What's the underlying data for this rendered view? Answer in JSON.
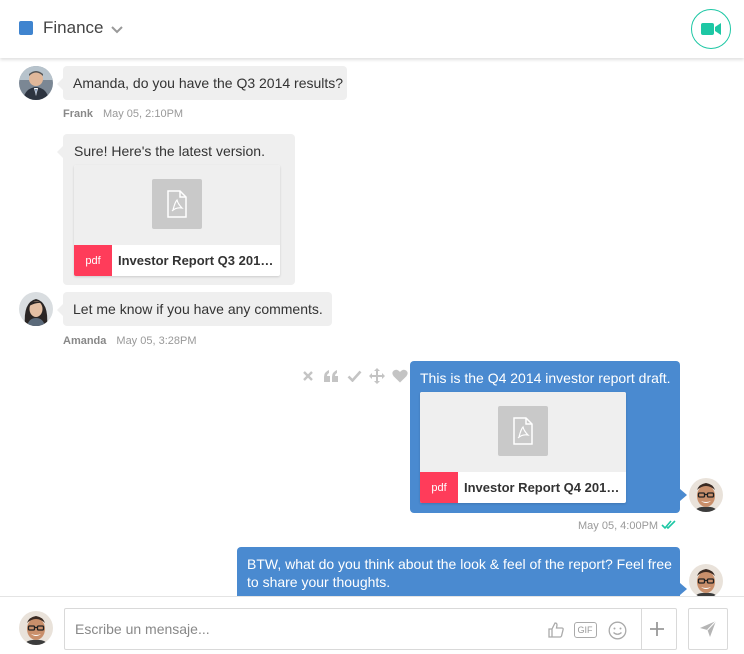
{
  "header": {
    "channel_name": "Finance",
    "channel_color": "#3f84cf",
    "accent_color": "#1dc7a4",
    "icons": {
      "channel": "square-icon",
      "dropdown": "chevron-down-icon",
      "video": "video-camera-icon"
    }
  },
  "messages": [
    {
      "direction": "incoming",
      "text": "Amanda, do you have the Q3 2014 results?",
      "sender": "Frank",
      "time": "May 05, 2:10PM"
    },
    {
      "direction": "incoming",
      "text": "Sure! Here's the latest version.",
      "attachment": {
        "type": "pdf",
        "name": "Investor Report Q3 2014...."
      }
    },
    {
      "direction": "incoming",
      "text": "Let me know if you have any comments.",
      "sender": "Amanda",
      "time": "May 05, 3:28PM"
    },
    {
      "direction": "outgoing",
      "text": "This is the Q4 2014 investor report draft.",
      "attachment": {
        "type": "pdf",
        "name": "Investor Report Q4 2014...."
      },
      "time": "May 05, 4:00PM",
      "status": "read"
    },
    {
      "direction": "outgoing",
      "text": "BTW, what do you think about the look & feel of the report? Feel free to share your thoughts."
    }
  ],
  "message_actions": [
    "close-icon",
    "quote-icon",
    "check-icon",
    "move-icon",
    "heart-icon"
  ],
  "composer": {
    "placeholder": "Escribe un mensaje...",
    "gif_label": "GIF",
    "tools": [
      "thumbs-up-icon",
      "gif-icon",
      "emoji-icon",
      "plus-icon"
    ],
    "send_icon": "send-icon"
  },
  "colors": {
    "incoming_bubble": "#efefef",
    "outgoing_bubble": "#4a8ad0",
    "pdf_badge": "#ff3c5a",
    "read_check": "#1dc7a4"
  }
}
